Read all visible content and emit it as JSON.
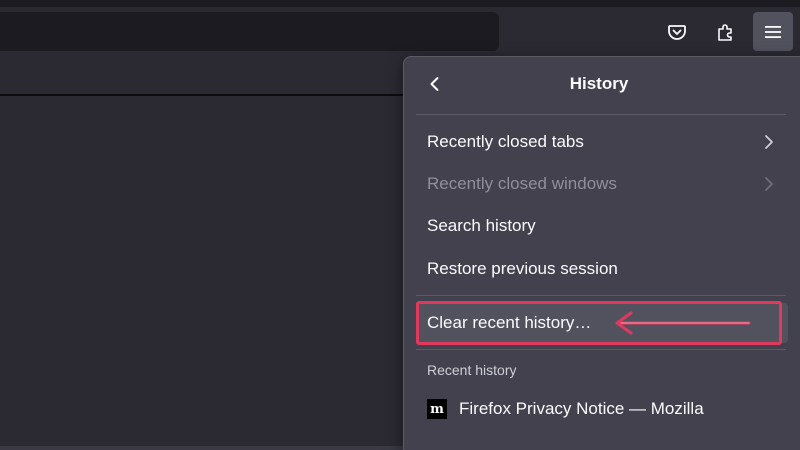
{
  "toolbar": {
    "pocket_icon": "pocket-icon",
    "extensions_icon": "puzzle-extensions-icon",
    "menu_icon": "hamburger-menu-icon"
  },
  "panel": {
    "title": "History",
    "back_icon": "chevron-left-icon",
    "items": [
      {
        "label": "Recently closed tabs",
        "has_submenu": true,
        "enabled": true
      },
      {
        "label": "Recently closed windows",
        "has_submenu": true,
        "enabled": false
      },
      {
        "label": "Search history",
        "has_submenu": false,
        "enabled": true
      },
      {
        "label": "Restore previous session",
        "has_submenu": false,
        "enabled": true
      }
    ],
    "clear_history": {
      "label": "Clear recent history…",
      "highlighted": true
    },
    "recent_history_label": "Recent history",
    "recent_history": [
      {
        "favicon_text": "m",
        "title": "Firefox Privacy Notice — Mozilla"
      }
    ]
  },
  "annotation": {
    "color": "#e0395d",
    "type": "arrow-and-box"
  },
  "colors": {
    "panel_bg": "#42414d",
    "toolbar_bg": "#2b2a33",
    "urlbar_bg": "#1c1b22",
    "accent_red": "#e0395d",
    "disabled_text": "#8f8f9d"
  }
}
